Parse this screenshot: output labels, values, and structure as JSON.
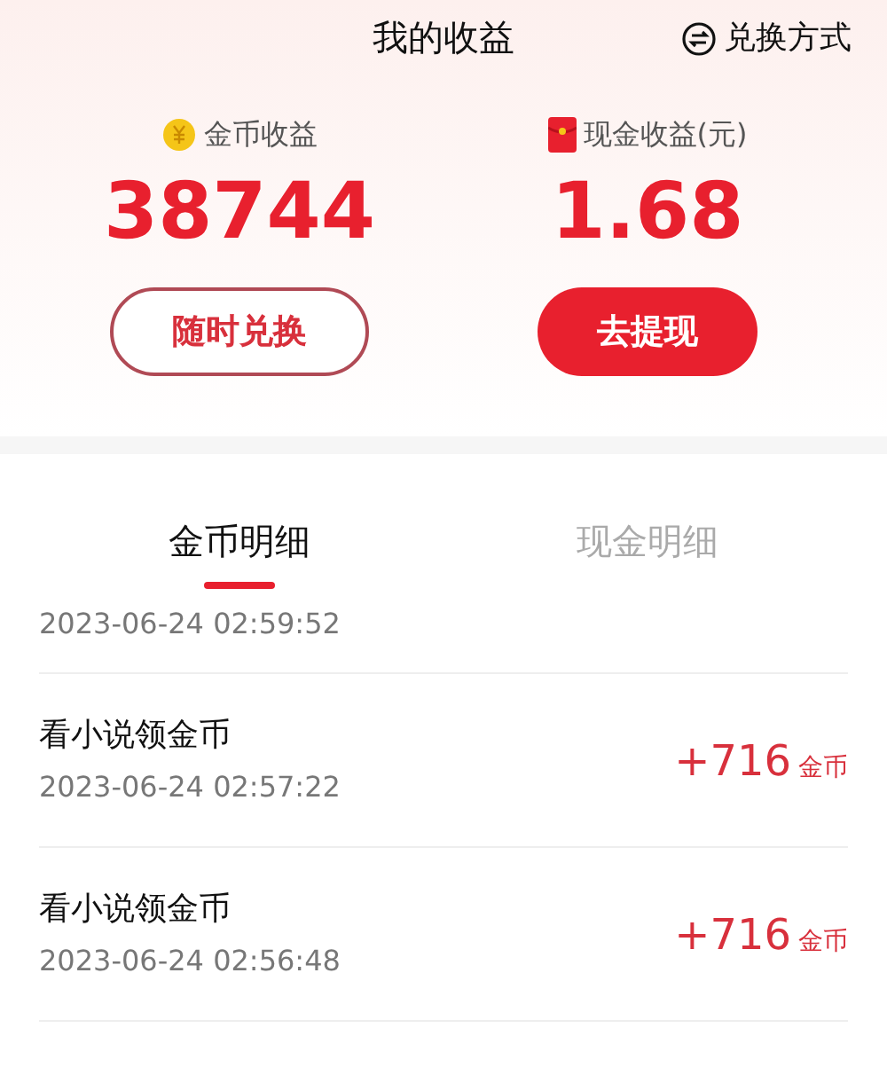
{
  "header": {
    "title": "我的收益",
    "action": "兑换方式"
  },
  "balances": [
    {
      "kind": "coin",
      "label": "金币收益",
      "amount": "38744",
      "button": "随时兑换",
      "primary": false
    },
    {
      "kind": "cash",
      "label": "现金收益(元)",
      "amount": "1.68",
      "button": "去提现",
      "primary": true
    }
  ],
  "tabs": [
    {
      "label": "金币明细",
      "selected": true
    },
    {
      "label": "现金明细",
      "selected": false
    }
  ],
  "records": [
    {
      "time": "2023-06-24 02:59:52"
    },
    {
      "title": "看小说领金币",
      "time": "2023-06-24 02:57:22",
      "amount": "+716",
      "unit": "金币"
    },
    {
      "title": "看小说领金币",
      "time": "2023-06-24 02:56:48",
      "amount": "+716",
      "unit": "金币"
    }
  ]
}
